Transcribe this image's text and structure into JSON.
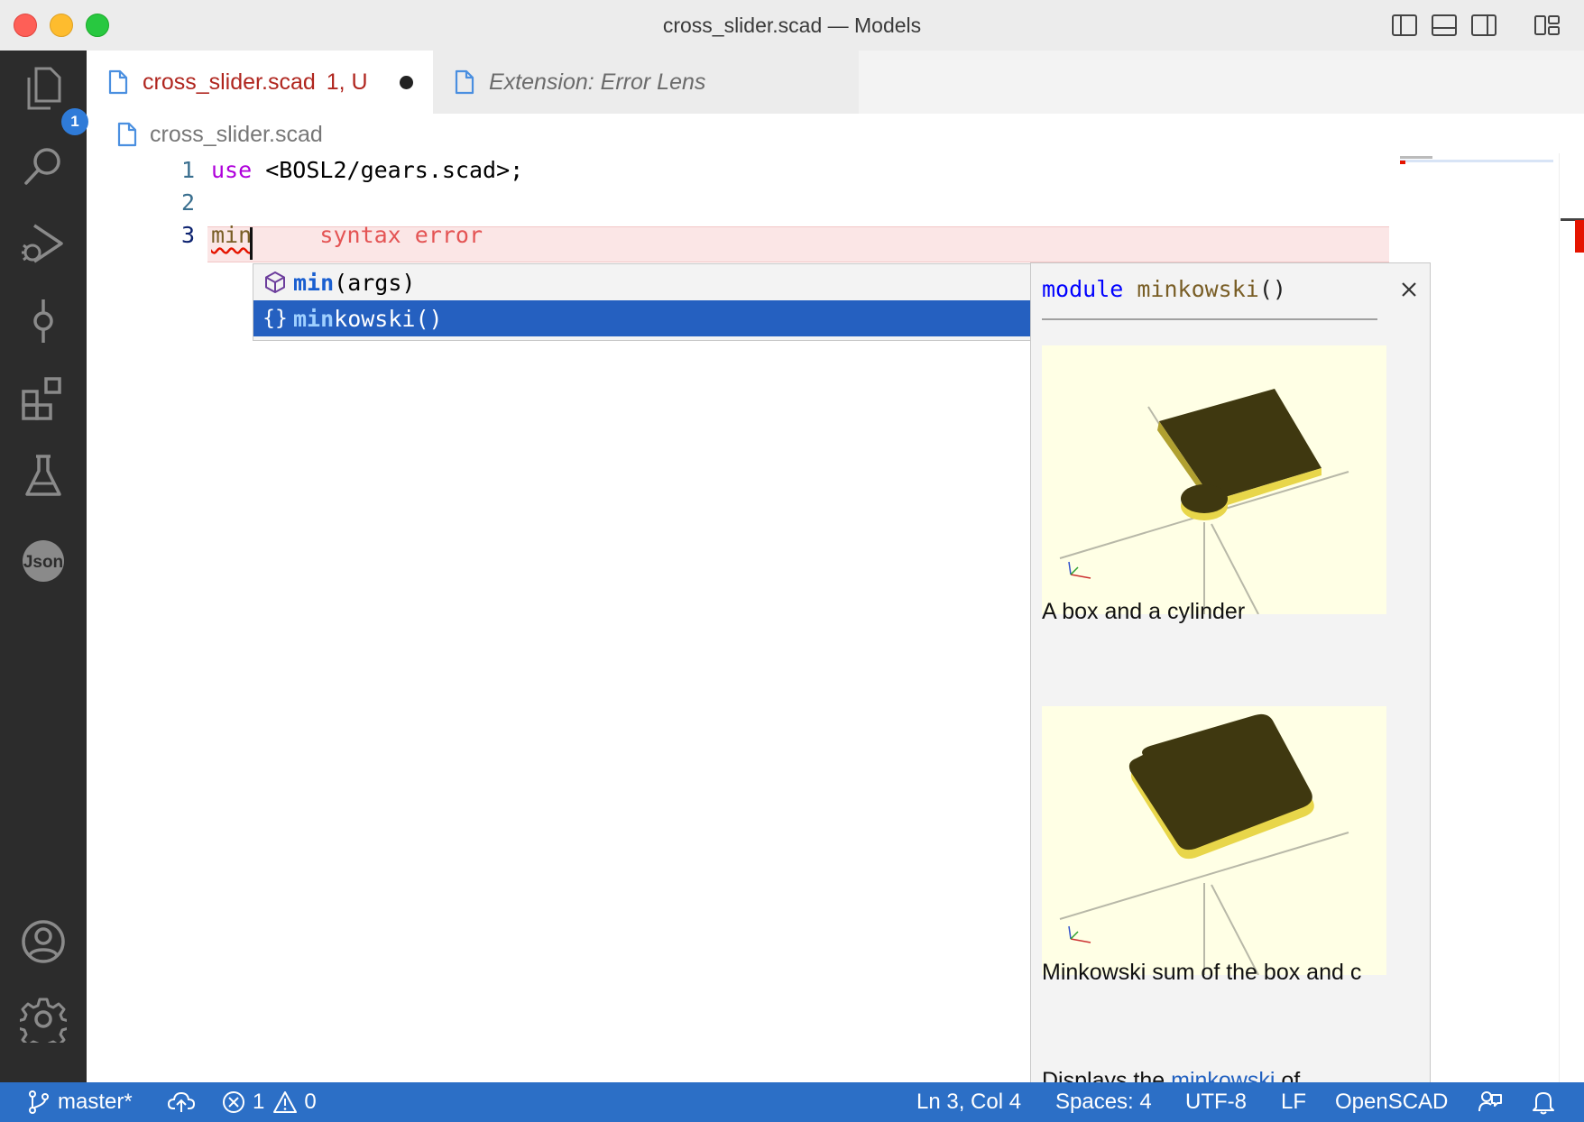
{
  "window": {
    "title": "cross_slider.scad — Models"
  },
  "activity_bar": {
    "explorer_badge": "1"
  },
  "tabs": [
    {
      "name": "cross_slider.scad",
      "status": "1, U"
    },
    {
      "name": "Extension: Error Lens"
    }
  ],
  "breadcrumb": {
    "file": "cross_slider.scad"
  },
  "editor": {
    "lines": [
      {
        "number": "1",
        "keyword": "use",
        "rest": " <BOSL2/gears.scad>;"
      },
      {
        "number": "2",
        "text": ""
      },
      {
        "number": "3",
        "typed": "min",
        "error_lens": "syntax error"
      }
    ]
  },
  "suggest": {
    "items": [
      {
        "match": "min",
        "rest": "(args)",
        "icon": "cube-icon"
      },
      {
        "match": "min",
        "rest": "kowski()",
        "icon": "braces-icon",
        "selected": true
      }
    ]
  },
  "docs": {
    "keyword": "module",
    "name": "minkowski",
    "parens": "()",
    "caption1": "A box and a cylinder",
    "caption2": "Minkowski sum of the box and c",
    "partial_text": "Displays the",
    "partial_link": "minkowski",
    "partial_tail": "of"
  },
  "status_bar": {
    "branch": "master*",
    "errors": "1",
    "warnings": "0",
    "position": "Ln 3, Col 4",
    "spaces": "Spaces: 4",
    "encoding": "UTF-8",
    "eol": "LF",
    "language": "OpenSCAD"
  },
  "colors": {
    "status_bar": "#2c6fc6",
    "activity_bar": "#2c2c2c",
    "selection": "#2560c0",
    "error": "#e51400"
  }
}
